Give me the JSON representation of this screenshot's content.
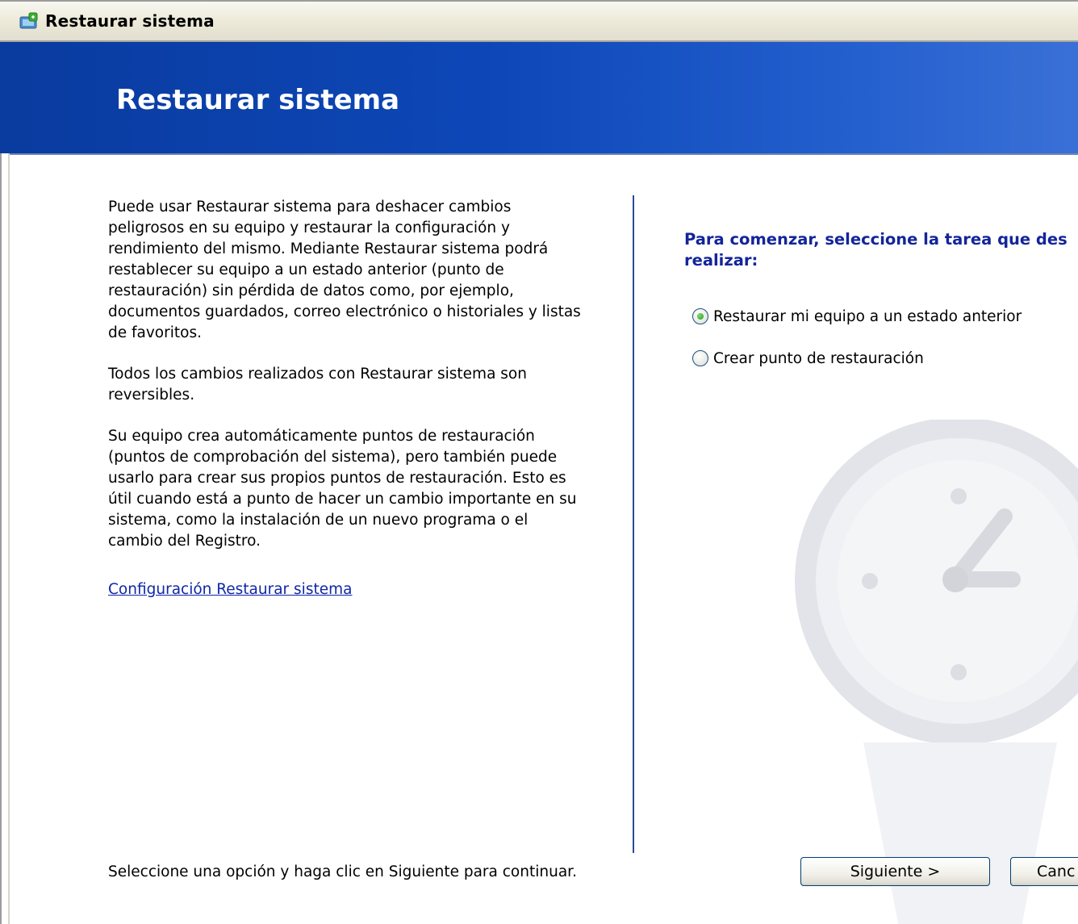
{
  "window": {
    "title": "Restaurar sistema"
  },
  "banner": {
    "title": "Restaurar sistema"
  },
  "left": {
    "paragraphs": [
      "Puede usar Restaurar sistema para deshacer cambios peligrosos en su equipo y restaurar la configuración y rendimiento del mismo. Mediante Restaurar sistema podrá restablecer su equipo a un estado anterior (punto de restauración) sin pérdida de datos como, por ejemplo, documentos guardados, correo electrónico o historiales y listas de favoritos.",
      "Todos los cambios realizados con Restaurar sistema son reversibles.",
      "Su equipo crea automáticamente puntos de restauración (puntos de comprobación del sistema), pero también puede usarlo para crear sus propios puntos de restauración. Esto es útil cuando está a punto de hacer un cambio importante en su sistema, como la instalación de un nuevo programa o el cambio del Registro."
    ],
    "settings_link": "Configuración Restaurar sistema",
    "footer": "Seleccione una opción y haga clic en Siguiente para continuar."
  },
  "right": {
    "prompt_line1": "Para comenzar, seleccione la tarea que des",
    "prompt_line2": "realizar:",
    "options": [
      {
        "label": "Restaurar mi equipo a un estado anterior",
        "selected": true
      },
      {
        "label": "Crear punto de restauración",
        "selected": false
      }
    ]
  },
  "buttons": {
    "next": "Siguiente >",
    "cancel": "Canc"
  },
  "colors": {
    "banner_dark": "#0a3b9f",
    "banner_light": "#3a70d6",
    "prompt_text": "#13259a",
    "link": "#0f27a8",
    "divider": "#2a4b9a"
  }
}
